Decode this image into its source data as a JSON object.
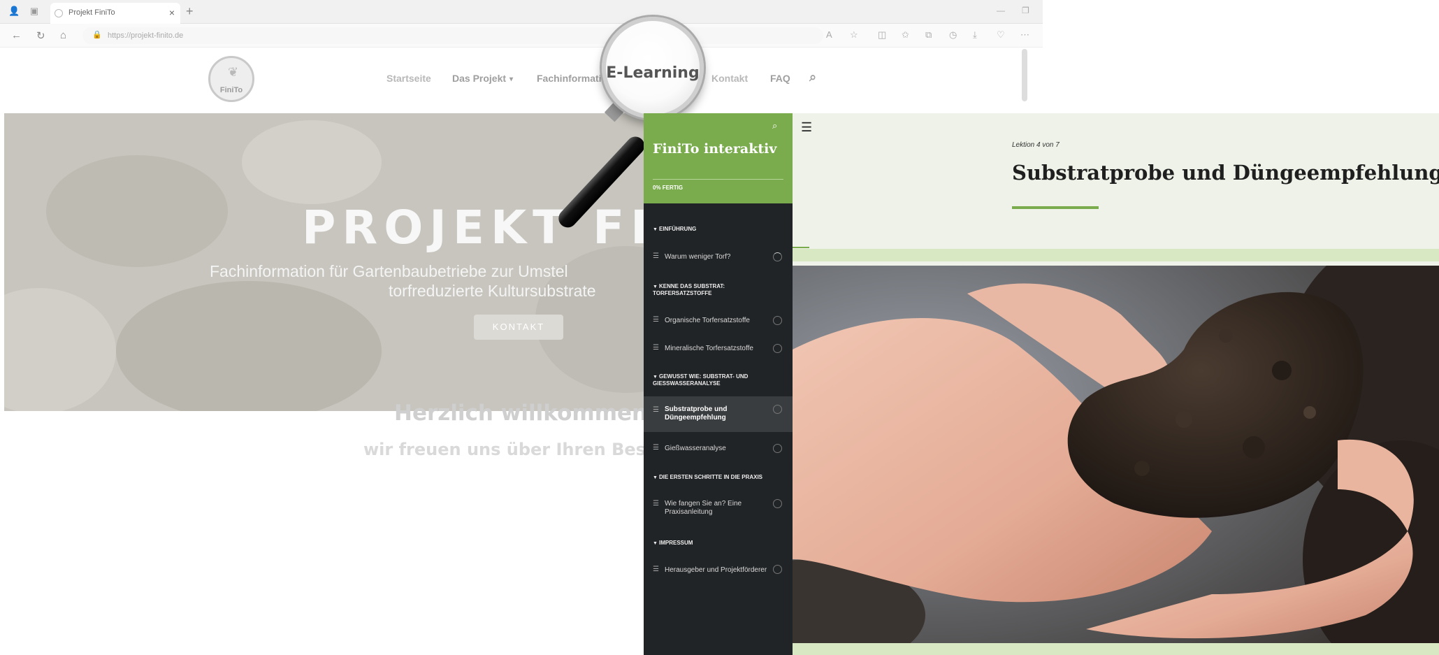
{
  "browser": {
    "tab_title": "Projekt FiniTo",
    "tab_close": "×",
    "new_tab": "+",
    "url": "https://projekt-finito.de"
  },
  "site": {
    "logo_text": "FiniTo",
    "menu": [
      "Startseite",
      "Das Projekt",
      "Fachinformationen",
      "Kontakt",
      "FAQ"
    ],
    "magnified_item": "E-Learning",
    "hero_title": "PROJEKT FINI",
    "hero_subtitle_line1": "Fachinformation für Gartenbaubetriebe zur Umstel",
    "hero_subtitle_line2": "torfreduzierte Kultursubstrate",
    "hero_button": "KONTAKT",
    "welcome_heading": "Herzlich willkommen,",
    "welcome_sub": "wir freuen uns über Ihren Besu"
  },
  "elearning": {
    "sidebar_title": "FiniTo interaktiv",
    "progress": "0% FERTIG",
    "sections": [
      {
        "title": "EINFÜHRUNG",
        "lessons": [
          "Warum weniger Torf?"
        ]
      },
      {
        "title": "KENNE DAS SUBSTRAT: TORFERSATZSTOFFE",
        "lessons": [
          "Organische Torfersatzstoffe",
          "Mineralische Torfersatzstoffe"
        ]
      },
      {
        "title": "GEWUSST WIE: SUBSTRAT- UND GIESSWASSERANALYSE",
        "lessons": [
          "Substratprobe und Düngeempfehlung",
          "Gießwasseranalyse"
        ]
      },
      {
        "title": "DIE ERSTEN SCHRITTE IN DIE PRAXIS",
        "lessons": [
          "Wie fangen Sie an? Eine Praxisanleitung"
        ]
      },
      {
        "title": "IMPRESSUM",
        "lessons": [
          "Herausgeber und Projektförderer"
        ]
      }
    ],
    "lesson_counter": "Lektion 4 von 7",
    "lesson_title": "Substratprobe und Düngeempfehlung"
  },
  "colors": {
    "accent_green": "#7aac4e",
    "sidebar_dark": "#212426",
    "content_bg": "#eef2e8",
    "band_green": "#d8e8c3"
  }
}
